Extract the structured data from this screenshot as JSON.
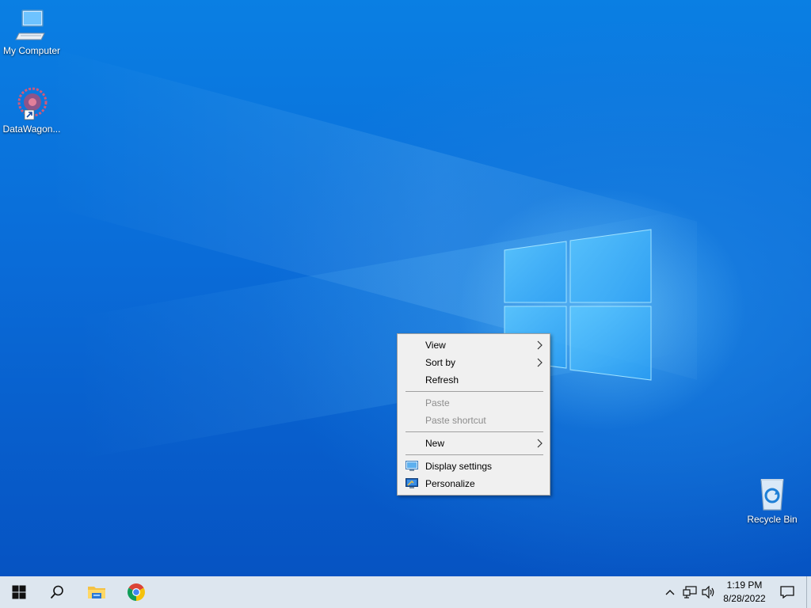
{
  "desktop": {
    "icons": [
      {
        "label": "My Computer",
        "icon": "computer-icon"
      },
      {
        "label": "DataWagon...",
        "icon": "datawagon-shortcut-icon"
      },
      {
        "label": "Recycle Bin",
        "icon": "recycle-bin-icon"
      }
    ]
  },
  "context_menu": {
    "items": [
      {
        "label": "View",
        "submenu": true,
        "enabled": true
      },
      {
        "label": "Sort by",
        "submenu": true,
        "enabled": true
      },
      {
        "label": "Refresh",
        "submenu": false,
        "enabled": true
      },
      {
        "label": "Paste",
        "submenu": false,
        "enabled": false
      },
      {
        "label": "Paste shortcut",
        "submenu": false,
        "enabled": false
      },
      {
        "label": "New",
        "submenu": true,
        "enabled": true
      },
      {
        "label": "Display settings",
        "submenu": false,
        "enabled": true,
        "icon": "display-settings-icon"
      },
      {
        "label": "Personalize",
        "submenu": false,
        "enabled": true,
        "icon": "personalize-icon"
      }
    ]
  },
  "taskbar": {
    "buttons": [
      "start-icon",
      "search-icon",
      "file-explorer-icon",
      "chrome-icon"
    ],
    "tray": [
      "chevron-up-icon",
      "network-icon",
      "volume-icon",
      "notifications-icon"
    ],
    "clock": {
      "time": "1:19 PM",
      "date": "8/28/2022"
    }
  },
  "colors": {
    "accent": "#0a6cd8",
    "taskbar": "#dde6ef",
    "menu_bg": "#f0f0f0",
    "disabled_text": "#8d8d8d"
  }
}
